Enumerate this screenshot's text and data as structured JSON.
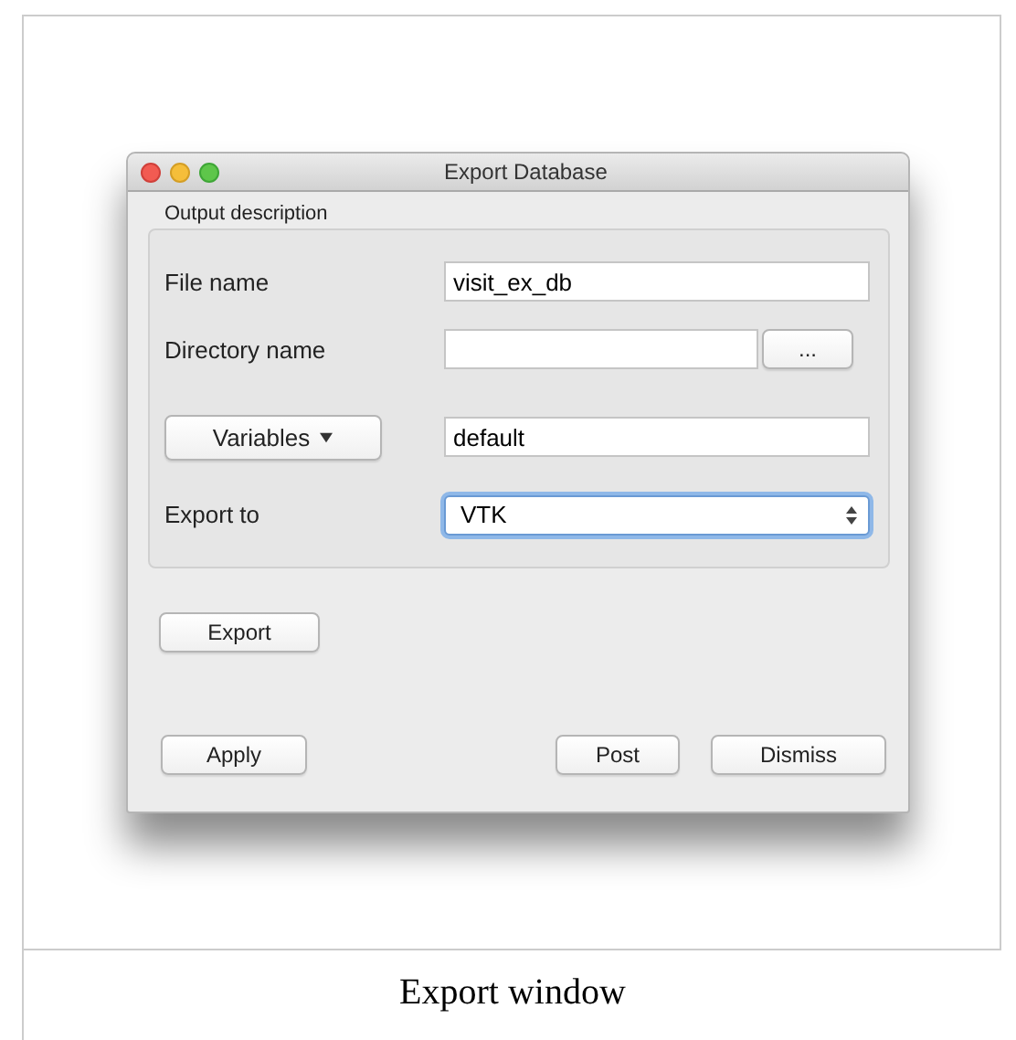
{
  "window": {
    "title": "Export Database"
  },
  "group": {
    "title": "Output description",
    "rows": [
      {
        "kind": "text",
        "label": "File name",
        "value": "visit_ex_db"
      },
      {
        "kind": "browse",
        "label": "Directory name",
        "value": "",
        "button": "..."
      },
      {
        "kind": "menu",
        "label": "Variables",
        "value": "default"
      },
      {
        "kind": "combo",
        "label": "Export to",
        "value": "VTK",
        "focused": true
      }
    ]
  },
  "export_button": "Export",
  "left_buttons": [
    "Apply"
  ],
  "right_buttons": [
    "Post",
    "Dismiss"
  ],
  "caption": "Export window"
}
